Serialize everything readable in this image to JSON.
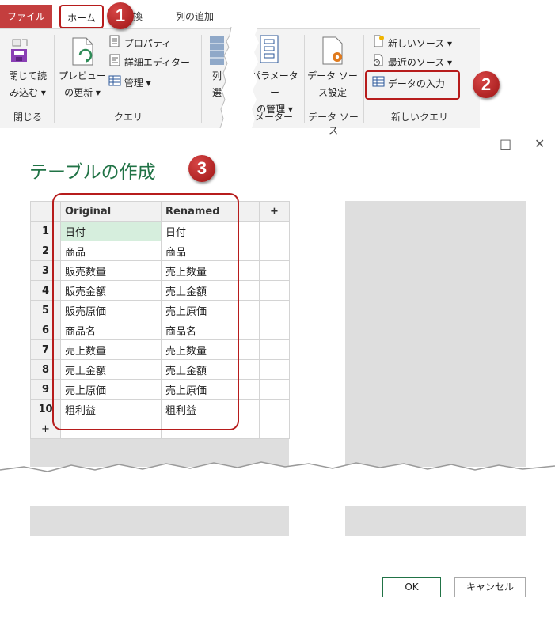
{
  "ribbon": {
    "tabs": {
      "file": "ファイル",
      "home": "ホーム",
      "transform": "換",
      "add_column": "列の追加"
    },
    "close_load_label_1": "閉じて読",
    "close_load_label_2": "み込む ▾",
    "close_group": "閉じる",
    "preview_label_1": "プレビュー",
    "preview_label_2": "の更新 ▾",
    "properties": "プロパティ",
    "advanced_editor": "詳細エディター",
    "manage": "管理 ▾",
    "query_group": "クエリ",
    "partial_label_1": "列",
    "partial_label_2": "選",
    "param_label_1": "パラメーター",
    "param_label_2": "の管理 ▾",
    "param_group": "メーター",
    "datasource_label_1": "データ ソー",
    "datasource_label_2": "ス設定",
    "datasource_group": "データ ソース",
    "new_source": "新しいソース ▾",
    "recent_source": "最近のソース ▾",
    "enter_data": "データの入力",
    "new_query_group": "新しいクエリ"
  },
  "badges": [
    "1",
    "2",
    "3"
  ],
  "dialog": {
    "title": "テーブルの作成",
    "maximize": "□",
    "close": "✕",
    "columns": [
      "Original",
      "Renamed"
    ],
    "add_column": "+",
    "add_row": "+",
    "rows": [
      {
        "n": "1",
        "original": "日付",
        "renamed": "日付"
      },
      {
        "n": "2",
        "original": "商品",
        "renamed": "商品"
      },
      {
        "n": "3",
        "original": "販売数量",
        "renamed": "売上数量"
      },
      {
        "n": "4",
        "original": "販売金額",
        "renamed": "売上金額"
      },
      {
        "n": "5",
        "original": "販売原価",
        "renamed": "売上原価"
      },
      {
        "n": "6",
        "original": "商品名",
        "renamed": "商品名"
      },
      {
        "n": "7",
        "original": "売上数量",
        "renamed": "売上数量"
      },
      {
        "n": "8",
        "original": "売上金額",
        "renamed": "売上金額"
      },
      {
        "n": "9",
        "original": "売上原価",
        "renamed": "売上原価"
      },
      {
        "n": "10",
        "original": "粗利益",
        "renamed": "粗利益"
      }
    ],
    "ok": "OK",
    "cancel": "キャンセル"
  },
  "colors": {
    "file_tab": "#c43e3e",
    "highlight": "#b71c1c",
    "title_green": "#217346",
    "selected_cell": "#d6eedd"
  }
}
